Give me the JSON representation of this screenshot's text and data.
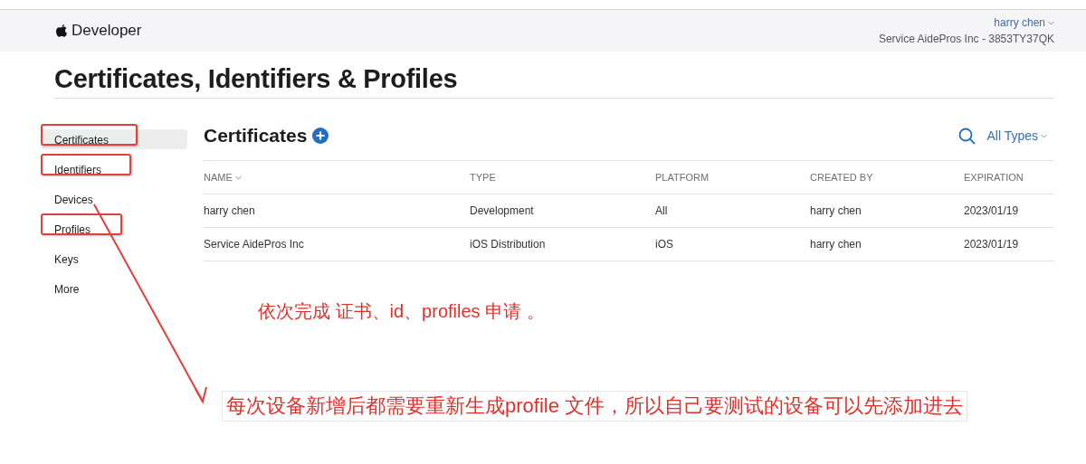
{
  "header": {
    "brand": "Developer",
    "user": "harry chen",
    "team": "Service AidePros Inc - 3853TY37QK"
  },
  "page_title": "Certificates, Identifiers & Profiles",
  "sidebar": {
    "items": [
      {
        "label": "Certificates",
        "selected": true,
        "annotated": true
      },
      {
        "label": "Identifiers",
        "selected": false,
        "annotated": true
      },
      {
        "label": "Devices",
        "selected": false,
        "annotated": false
      },
      {
        "label": "Profiles",
        "selected": false,
        "annotated": true
      },
      {
        "label": "Keys",
        "selected": false,
        "annotated": false
      },
      {
        "label": "More",
        "selected": false,
        "annotated": false
      }
    ]
  },
  "section": {
    "title": "Certificates",
    "filter": "All Types"
  },
  "table": {
    "columns": [
      {
        "label": "NAME",
        "sortable": true
      },
      {
        "label": "TYPE",
        "sortable": false
      },
      {
        "label": "PLATFORM",
        "sortable": false
      },
      {
        "label": "CREATED BY",
        "sortable": false
      },
      {
        "label": "EXPIRATION",
        "sortable": false
      }
    ],
    "rows": [
      [
        "harry chen",
        "Development",
        "All",
        "harry chen",
        "2023/01/19"
      ],
      [
        "Service AidePros Inc",
        "iOS Distribution",
        "iOS",
        "harry chen",
        "2023/01/19"
      ]
    ]
  },
  "annotations": [
    "依次完成 证书、id、profiles 申请 。",
    "每次设备新增后都需要重新生成profile 文件，所以自己要测试的设备可以先添加进去"
  ]
}
